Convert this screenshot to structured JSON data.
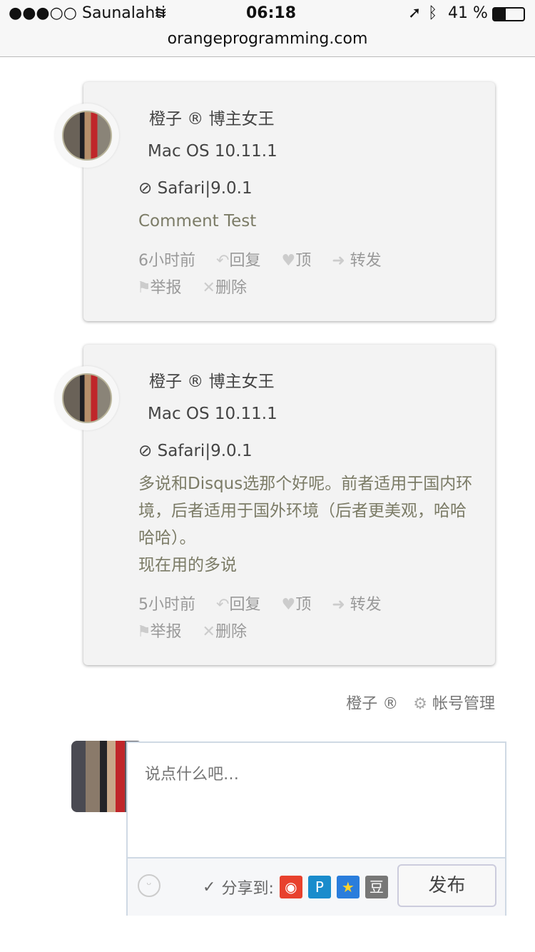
{
  "status": {
    "carrier": "●●●○○ Saunalahti",
    "wifi_icon": "wifi-icon",
    "time": "06:18",
    "battery": "41 %",
    "url": "orangeprogramming.com"
  },
  "comments": [
    {
      "name": "橙子 ®  博主女王",
      "os": "Mac OS 10.11.1",
      "browser": "Safari|9.0.1",
      "text": "Comment Test",
      "time": "6小时前",
      "reply": "回复",
      "like": "顶",
      "forward": "转发",
      "report": "举报",
      "delete": "删除"
    },
    {
      "name": "橙子 ®  博主女王",
      "os": "Mac OS 10.11.1",
      "browser": "Safari|9.0.1",
      "text": "多说和Disqus选那个好呢。前者适用于国内环境，后者适用于国外环境（后者更美观，哈哈哈哈）。\n现在用的多说",
      "time": "5小时前",
      "reply": "回复",
      "like": "顶",
      "forward": "转发",
      "report": "举报",
      "delete": "删除"
    }
  ],
  "account": {
    "user": "橙子 ®",
    "manage": "帐号管理"
  },
  "composer": {
    "placeholder": "说点什么吧…",
    "share_label": "分享到:",
    "submit": "发布",
    "share_targets": [
      "weibo",
      "pengyou",
      "qzone",
      "douban"
    ],
    "douban_glyph": "豆"
  }
}
